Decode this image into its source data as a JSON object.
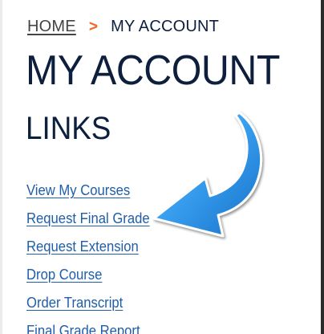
{
  "breadcrumb": {
    "home": "HOME",
    "separator": ">",
    "current": "MY ACCOUNT"
  },
  "page": {
    "title": "MY ACCOUNT",
    "subtitle": "LINKS"
  },
  "links": [
    "View My Courses",
    "Request Final Grade",
    "Request Extension",
    "Drop Course",
    "Order Transcript",
    "Final Grade Report"
  ],
  "colors": {
    "heading": "#0d1f3d",
    "link": "#1f5ea8",
    "breadcrumb_separator": "#f26522",
    "arrow": "#3aa0f0"
  },
  "icons": {
    "pointer_arrow": "curved-arrow-icon"
  }
}
